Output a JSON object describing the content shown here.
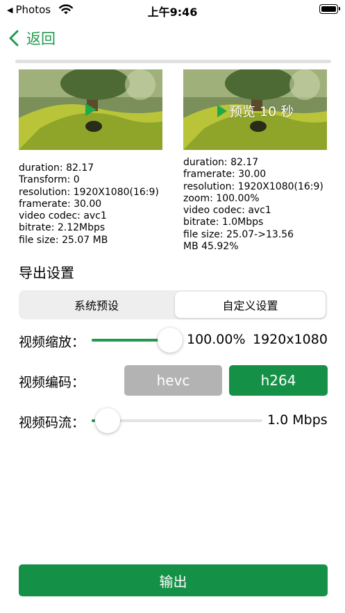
{
  "status_bar": {
    "back_app": "Photos",
    "time": "上午9:46"
  },
  "nav": {
    "back_label": "返回"
  },
  "colors": {
    "accent": "#159147",
    "disabled": "#b3b3b3"
  },
  "original": {
    "duration": "duration: 82.17",
    "transform": "Transform: 0",
    "resolution": "resolution: 1920X1080(16:9)",
    "framerate": "framerate: 30.00",
    "video_codec": "video codec: avc1",
    "bitrate": "bitrate: 2.12Mbps",
    "file_size": "file size: 25.07 MB"
  },
  "output": {
    "preview_label": "预览 10 秒",
    "duration": "duration: 82.17",
    "framerate": "framerate: 30.00",
    "resolution": "resolution: 1920X1080(16:9)",
    "zoom": "zoom: 100.00%",
    "video_codec": "video codec: avc1",
    "bitrate": "bitrate: 1.0Mbps",
    "file_size_line1": "file size: 25.07->13.56",
    "file_size_line2": "MB 45.92%"
  },
  "settings": {
    "title": "导出设置",
    "tabs": [
      "系统预设",
      "自定义设置"
    ],
    "selected_tab": "自定义设置",
    "scale": {
      "label": "视频缩放：",
      "percent": "100.00%",
      "resolution": "1920x1080",
      "level": 1.0
    },
    "codec": {
      "label": "视频编码：",
      "options": [
        "hevc",
        "h264"
      ],
      "selected": "h264"
    },
    "bitrate": {
      "label": "视频码流：",
      "value": "1.0 Mbps",
      "level": 0.02
    }
  },
  "export_label": "输出"
}
